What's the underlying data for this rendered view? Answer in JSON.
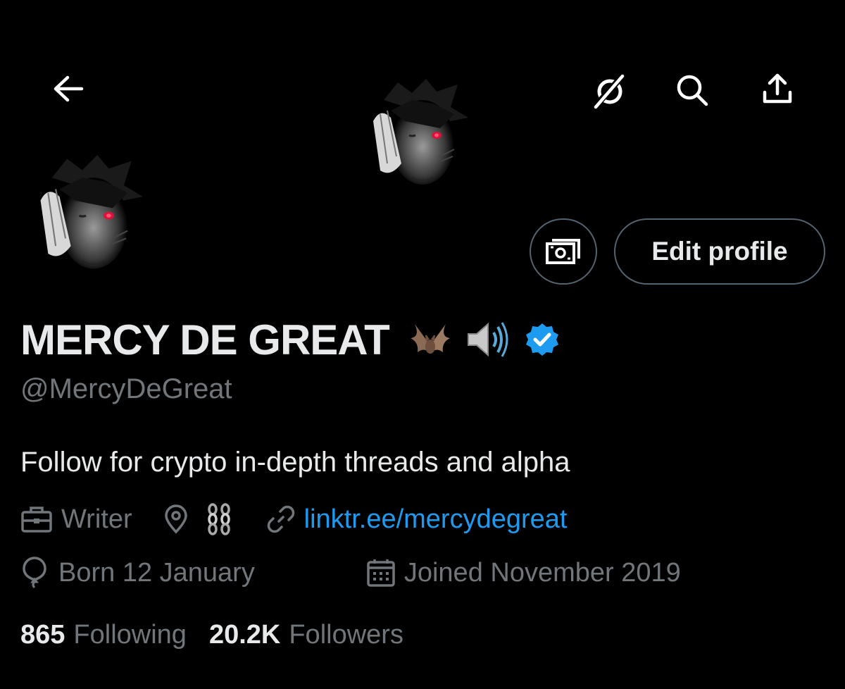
{
  "profile": {
    "display_name": "MERCY DE GREAT",
    "name_emojis": [
      "bat-emoji",
      "speaker-emoji"
    ],
    "verified": true,
    "handle": "@MercyDeGreat",
    "bio": "Follow for crypto in-depth threads and alpha",
    "profession": "Writer",
    "location_emoji": "chain-emoji",
    "link_text": "linktr.ee/mercydegreat",
    "birthday": "Born 12 January",
    "joined": "Joined November 2019"
  },
  "actions": {
    "edit_profile_label": "Edit profile"
  },
  "stats": {
    "following_count": "865",
    "following_label": "Following",
    "followers_count": "20.2K",
    "followers_label": "Followers"
  },
  "icons": {
    "back": "arrow-left-icon",
    "grok": "grok-icon",
    "search": "search-icon",
    "share": "share-icon",
    "tip": "money-icon",
    "verified": "verified-badge-icon",
    "profession": "briefcase-icon",
    "location": "location-pin-icon",
    "link": "link-icon",
    "birthday": "balloon-icon",
    "calendar": "calendar-icon"
  },
  "colors": {
    "background": "#000000",
    "primary_text": "#e7e9ea",
    "secondary_text": "#71767b",
    "link": "#1d9bf0",
    "verified": "#1d9bf0",
    "border": "#536471"
  }
}
